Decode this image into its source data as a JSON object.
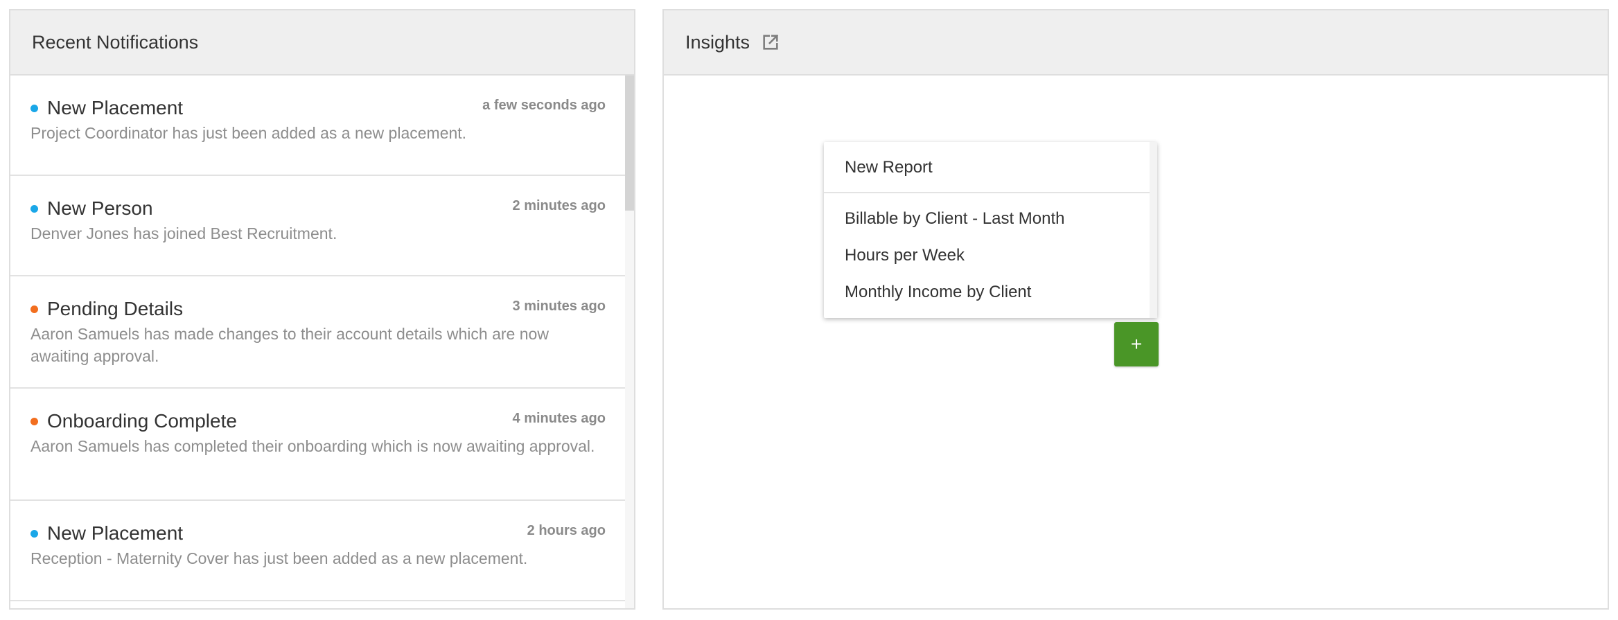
{
  "notifications_panel": {
    "title": "Recent Notifications",
    "items": [
      {
        "title": "New Placement",
        "time": "a few seconds ago",
        "body": "Project Coordinator has just been added as a new placement.",
        "status_color": "#1aa7e8"
      },
      {
        "title": "New Person",
        "time": "2 minutes ago",
        "body": "Denver Jones has joined Best Recruitment.",
        "status_color": "#1aa7e8"
      },
      {
        "title": "Pending Details",
        "time": "3 minutes ago",
        "body": "Aaron Samuels has made changes to their account details which are now awaiting approval.",
        "status_color": "#f26e1f"
      },
      {
        "title": "Onboarding Complete",
        "time": "4 minutes ago",
        "body": "Aaron Samuels has completed their onboarding which is now awaiting approval.",
        "status_color": "#f26e1f"
      },
      {
        "title": "New Placement",
        "time": "2 hours ago",
        "body": "Reception - Maternity Cover has just been added as a new placement.",
        "status_color": "#1aa7e8"
      }
    ]
  },
  "insights_panel": {
    "title": "Insights",
    "header_icon": "external-link-icon",
    "menu": {
      "new_report": "New Report",
      "reports": [
        "Billable by Client - Last Month",
        "Hours per Week",
        "Monthly Income by Client"
      ]
    },
    "add_button_label": "+",
    "accent_color": "#4a9627"
  }
}
